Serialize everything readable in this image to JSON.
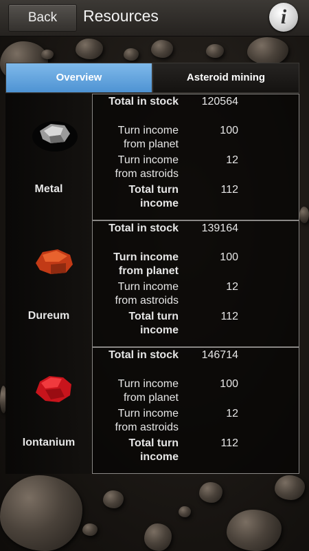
{
  "header": {
    "back_label": "Back",
    "title": "Resources",
    "info_label": "i"
  },
  "tabs": [
    {
      "label": "Overview",
      "active": true
    },
    {
      "label": "Asteroid mining",
      "active": false
    }
  ],
  "resources": [
    {
      "name": "Metal",
      "icon": "metal-ore-icon",
      "icon_color": "#8a8a8a",
      "total_in_stock_label": "Total in stock",
      "total_in_stock": "120564",
      "planet_label": [
        "Turn income",
        "from planet"
      ],
      "planet_income": "100",
      "asteroid_label": [
        "Turn income",
        "from astroids"
      ],
      "asteroid_income": "12",
      "total_turn_label": [
        "Total turn",
        "income"
      ],
      "total_turn_income": "112"
    },
    {
      "name": "Dureum",
      "icon": "dureum-ore-icon",
      "icon_color": "#d2451e",
      "total_in_stock_label": "Total in stock",
      "total_in_stock": "139164",
      "planet_label": [
        "Turn income",
        "from planet"
      ],
      "planet_income": "100",
      "asteroid_label": [
        "Turn income",
        "from astroids"
      ],
      "asteroid_income": "12",
      "total_turn_label": [
        "Total turn",
        "income"
      ],
      "total_turn_income": "112"
    },
    {
      "name": "Iontanium",
      "icon": "iontanium-ore-icon",
      "icon_color": "#e0222a",
      "total_in_stock_label": "Total in stock",
      "total_in_stock": "146714",
      "planet_label": [
        "Turn income",
        "from planet"
      ],
      "planet_income": "100",
      "asteroid_label": [
        "Turn income",
        "from astroids"
      ],
      "asteroid_income": "12",
      "total_turn_label": [
        "Total turn",
        "income"
      ],
      "total_turn_income": "112"
    }
  ],
  "colors": {
    "tab_active": "#5fa3de",
    "header": "#2f2c29"
  }
}
